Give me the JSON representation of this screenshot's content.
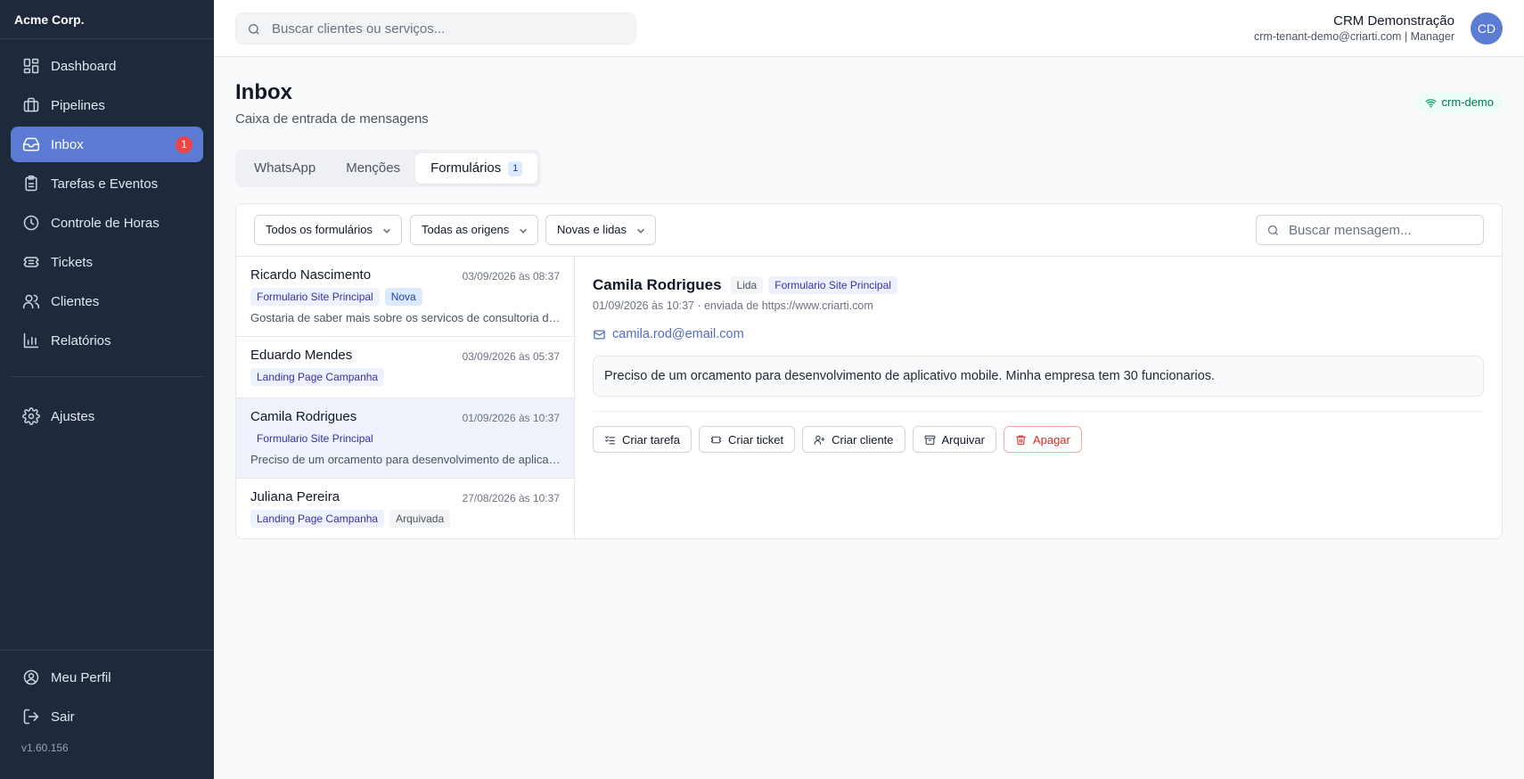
{
  "sidebar": {
    "brand": "Acme Corp.",
    "items": [
      {
        "label": "Dashboard"
      },
      {
        "label": "Pipelines"
      },
      {
        "label": "Inbox",
        "badge": "1"
      },
      {
        "label": "Tarefas e Eventos"
      },
      {
        "label": "Controle de Horas"
      },
      {
        "label": "Tickets"
      },
      {
        "label": "Clientes"
      },
      {
        "label": "Relatórios"
      }
    ],
    "settings_label": "Ajustes",
    "profile_label": "Meu Perfil",
    "logout_label": "Sair",
    "version": "v1.60.156"
  },
  "header": {
    "search_placeholder": "Buscar clientes ou serviços...",
    "user_name": "CRM Demonstração",
    "user_sub": "crm-tenant-demo@criarti.com | Manager",
    "avatar_initials": "CD"
  },
  "page": {
    "title": "Inbox",
    "subtitle": "Caixa de entrada de mensagens",
    "connection_label": "crm-demo"
  },
  "tabs": [
    {
      "label": "WhatsApp"
    },
    {
      "label": "Menções"
    },
    {
      "label": "Formulários",
      "count": "1"
    }
  ],
  "filters": {
    "form": "Todos os formulários",
    "origin": "Todas as origens",
    "status": "Novas e lidas",
    "search_placeholder": "Buscar mensagem..."
  },
  "messages": [
    {
      "name": "Ricardo Nascimento",
      "date": "03/09/2026 às 08:37",
      "form": "Formulario Site Principal",
      "status": "Nova",
      "preview": "Gostaria de saber mais sobre os servicos de consultoria de TI para minha empresa."
    },
    {
      "name": "Eduardo Mendes",
      "date": "03/09/2026 às 05:37",
      "form": "Landing Page Campanha"
    },
    {
      "name": "Camila Rodrigues",
      "date": "01/09/2026 às 10:37",
      "form": "Formulario Site Principal",
      "preview": "Preciso de um orcamento para desenvolvimento de aplicativo mobile. Minha empresa tem 30 funcionarios."
    },
    {
      "name": "Juliana Pereira",
      "date": "27/08/2026 às 10:37",
      "form": "Landing Page Campanha",
      "status": "Arquivada"
    }
  ],
  "detail": {
    "name": "Camila Rodrigues",
    "status": "Lida",
    "form": "Formulario Site Principal",
    "meta": "01/09/2026 às 10:37 · enviada de https://www.criarti.com",
    "email": "camila.rod@email.com",
    "message": "Preciso de um orcamento para desenvolvimento de aplicativo mobile. Minha empresa tem 30 funcionarios.",
    "actions": {
      "task": "Criar tarefa",
      "ticket": "Criar ticket",
      "client": "Criar cliente",
      "archive": "Arquivar",
      "delete": "Apagar"
    }
  },
  "colors": {
    "sidebar_bg": "#1e293b",
    "accent": "#5b7bd5",
    "badge_red": "#ef4444",
    "danger": "#dc2626"
  }
}
